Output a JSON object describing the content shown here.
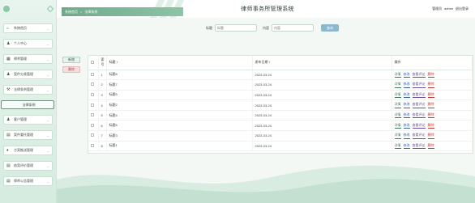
{
  "header": {
    "system_title": "律师事务所管理系统",
    "breadcrumb_home": "系统首页",
    "breadcrumb_sep": ">",
    "breadcrumb_current": "法律条例",
    "user_role": "管理员",
    "username": "admin",
    "logout": "退出登录"
  },
  "sidebar": {
    "items": [
      {
        "label": "系统首页",
        "icon": "home-icon",
        "glyph": "⌂"
      },
      {
        "label": "个人中心",
        "icon": "user-icon",
        "glyph": "♟"
      },
      {
        "label": "律师管理",
        "icon": "grid-icon",
        "glyph": "▦"
      },
      {
        "label": "案件分类管理",
        "icon": "user-icon",
        "glyph": "♟"
      },
      {
        "label": "法律条例管理",
        "icon": "gavel-icon",
        "glyph": "⚒"
      },
      {
        "label": "法律条例",
        "icon": "list-icon",
        "glyph": "☰"
      },
      {
        "label": "客户管理",
        "icon": "user-icon",
        "glyph": "♟"
      },
      {
        "label": "案件委托管理",
        "icon": "folder-icon",
        "glyph": "▤"
      },
      {
        "label": "方案推送管理",
        "icon": "lightbulb-icon",
        "glyph": "♦"
      },
      {
        "label": "结案评价管理",
        "icon": "folder-icon",
        "glyph": "▤"
      },
      {
        "label": "律师公告管理",
        "icon": "folder-icon",
        "glyph": "▤"
      }
    ]
  },
  "search": {
    "title_label": "标题",
    "title_placeholder": "标题",
    "content_label": "内容",
    "content_placeholder": "内容",
    "button": "查询"
  },
  "actions": {
    "add": "新增",
    "delete": "删除"
  },
  "table": {
    "headers": {
      "no": "索引",
      "title": "标题",
      "date": "发布日期",
      "ops": "操作"
    },
    "ops": {
      "view": "详情",
      "edit": "修改",
      "comment": "查看评论",
      "delete": "删除"
    },
    "rows": [
      {
        "no": "1",
        "title": "标题8",
        "date": "2023-03-24"
      },
      {
        "no": "2",
        "title": "标题7",
        "date": "2023-03-24"
      },
      {
        "no": "3",
        "title": "标题5",
        "date": "2023-03-24"
      },
      {
        "no": "4",
        "title": "标题2",
        "date": "2023-03-24"
      },
      {
        "no": "5",
        "title": "标题4",
        "date": "2023-03-24"
      },
      {
        "no": "6",
        "title": "标题6",
        "date": "2023-03-24"
      },
      {
        "no": "7",
        "title": "标题3",
        "date": "2023-03-24"
      },
      {
        "no": "8",
        "title": "标题1",
        "date": "2023-03-24"
      }
    ]
  }
}
